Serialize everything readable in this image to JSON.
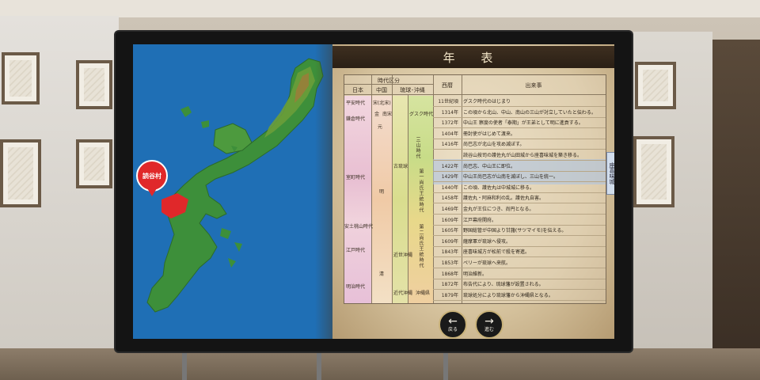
{
  "window": {
    "title": "年 表"
  },
  "map": {
    "callout_label": "読谷村",
    "island_color": "#3d8f3a",
    "highlight_color": "#e0282a",
    "sea_color": "#1f6fb5"
  },
  "table": {
    "header": {
      "era_group": "時代区分",
      "japan": "日本",
      "china": "中国",
      "ryukyu": "琉球･沖縄",
      "year": "西暦",
      "event": "出来事"
    },
    "japan_periods": [
      {
        "label": "平安時代"
      },
      {
        "label": "鎌倉時代"
      },
      {
        "label": "室町時代"
      },
      {
        "label": "安土桃山時代"
      },
      {
        "label": "江戸時代"
      },
      {
        "label": "明治時代"
      }
    ],
    "china_periods": [
      "宋(北宋)",
      "金",
      "南宋",
      "元",
      "明",
      "清"
    ],
    "ryukyu_periods": [
      "グスク時代",
      "三山時代",
      "古琉球",
      "第一尚氏王統時代",
      "第二尚氏王統時代",
      "近世沖縄",
      "近代沖縄",
      "沖縄県"
    ],
    "rows": [
      {
        "year": "11世紀頃",
        "event": "グスク時代のはじまり"
      },
      {
        "year": "1314年",
        "event": "この頃から北山、中山、南山の三山が対立していたと伝わる。"
      },
      {
        "year": "1372年",
        "event": "中山王 察度の使者「泰期」が王弟として明に進貢する。"
      },
      {
        "year": "1404年",
        "event": "冊封使がはじめて渡来。"
      },
      {
        "year": "1416年",
        "event": "尚巴志が北山を攻め滅ぼす。"
      },
      {
        "year": "",
        "event": "読谷山按司の護佐丸が山田城から座喜味城を築き移る。"
      },
      {
        "year": "1422年",
        "event": "尚巴志、中山王に即位。"
      },
      {
        "year": "1429年",
        "event": "中山王尚巴志が山南を滅ぼし、三山を統一。"
      },
      {
        "year": "1440年",
        "event": "この頃、護佐丸は中城城に移る。"
      },
      {
        "year": "1458年",
        "event": "護佐丸・阿麻和利の乱。護佐丸自害。"
      },
      {
        "year": "1469年",
        "event": "金丸が王位につき、尚円となる。"
      },
      {
        "year": "1609年",
        "event": "江戸幕府開府。"
      },
      {
        "year": "1605年",
        "event": "野国総管が中国より甘藷(サツマイモ)を伝える。"
      },
      {
        "year": "1609年",
        "event": "薩摩軍が琉球へ侵攻。"
      },
      {
        "year": "1843年",
        "event": "座喜味城方が松前で殺を寄進。"
      },
      {
        "year": "1853年",
        "event": "ペリーが琉球へ来航。"
      },
      {
        "year": "1868年",
        "event": "明治維新。"
      },
      {
        "year": "1872年",
        "event": "布告代により、琉球藩が設置される。"
      },
      {
        "year": "1879年",
        "event": "琉球処分により琉球藩から沖縄県となる。"
      }
    ],
    "highlight_label": "座喜味城",
    "highlight_color": "#aac3e6"
  },
  "nav": {
    "back_label": "戻る",
    "next_label": "進む",
    "back_icon": "arrow-left-icon",
    "next_icon": "arrow-right-icon"
  }
}
